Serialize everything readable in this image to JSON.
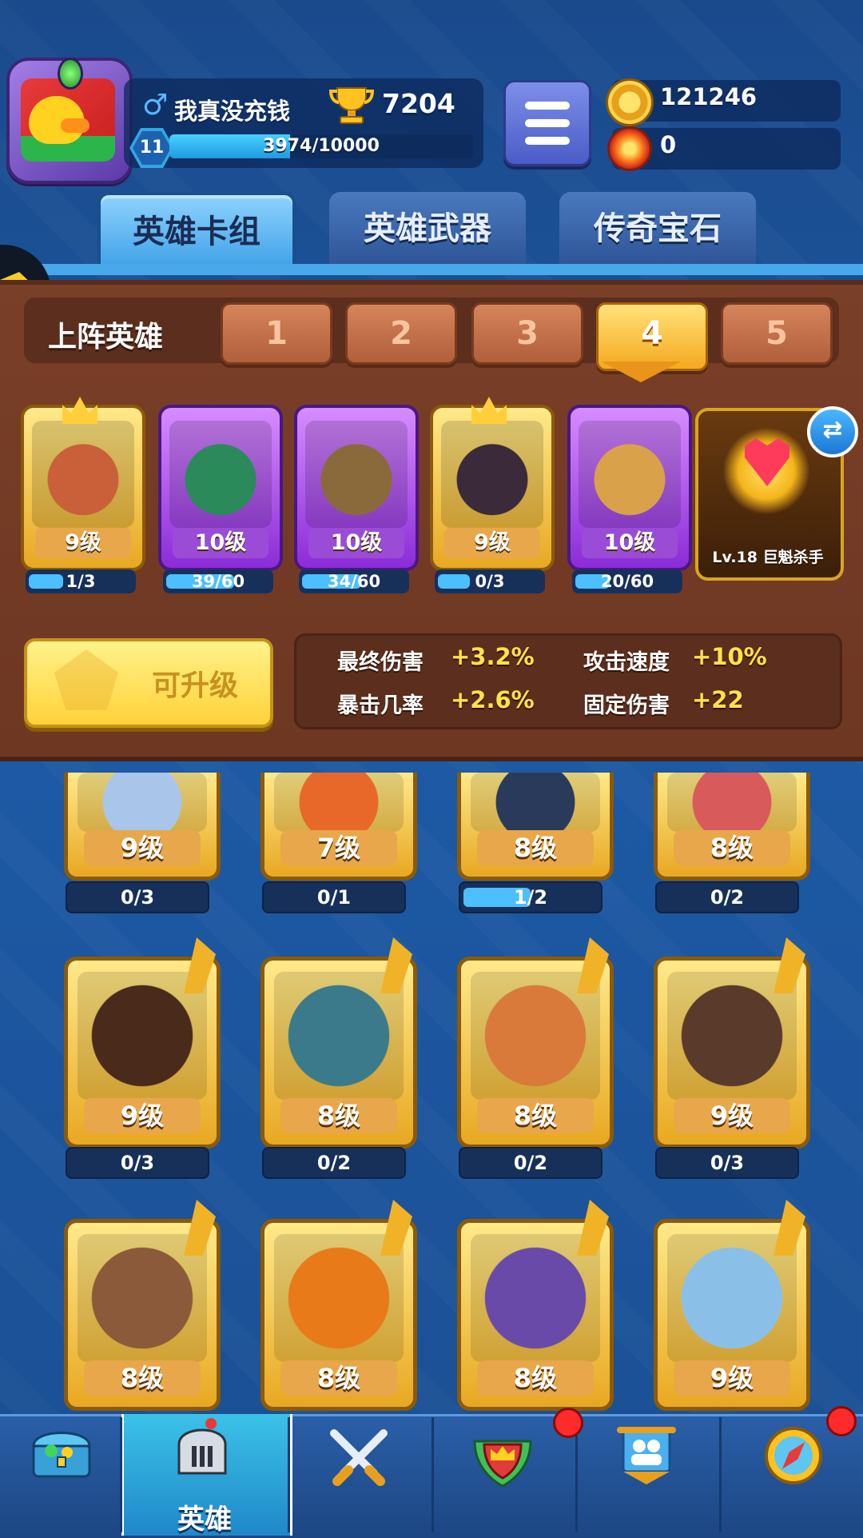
{
  "player": {
    "name": "我真没充钱",
    "trophies": "7204",
    "level": "11",
    "xp_text": "3974/10000",
    "xp_fraction": 0.3974
  },
  "currency": {
    "gold": "121246",
    "flames": "0"
  },
  "tabs": [
    {
      "label": "英雄卡组",
      "active": true
    },
    {
      "label": "英雄武器",
      "active": false
    },
    {
      "label": "传奇宝石",
      "active": false
    }
  ],
  "lineup": {
    "label": "上阵英雄",
    "slots": [
      "1",
      "2",
      "3",
      "4",
      "5"
    ],
    "active_slot": "4",
    "heroes": [
      {
        "level": "9级",
        "progress": "1/3",
        "fraction": 0.333,
        "rarity": "gold",
        "crown": true,
        "art_color": "#c9603a"
      },
      {
        "level": "10级",
        "progress": "39/60",
        "fraction": 0.65,
        "rarity": "purple",
        "crown": false,
        "art_color": "#2a8a5a"
      },
      {
        "level": "10级",
        "progress": "34/60",
        "fraction": 0.567,
        "rarity": "purple",
        "crown": false,
        "art_color": "#8a6a3a"
      },
      {
        "level": "9级",
        "progress": "0/3",
        "fraction": 0.0,
        "rarity": "gold",
        "crown": true,
        "art_color": "#3a2a3a"
      },
      {
        "level": "10级",
        "progress": "20/60",
        "fraction": 0.333,
        "rarity": "purple",
        "crown": false,
        "art_color": "#d9a24a"
      }
    ],
    "trophy_label": "Lv.18 巨魁杀手"
  },
  "upgrade": {
    "label": "可升级"
  },
  "stats": [
    {
      "name": "最终伤害",
      "value": "+3.2%"
    },
    {
      "name": "攻击速度",
      "value": "+10%"
    },
    {
      "name": "暴击几率",
      "value": "+2.6%"
    },
    {
      "name": "固定伤害",
      "value": "+22"
    }
  ],
  "roster": [
    {
      "level": "9级",
      "progress": "0/3",
      "fraction": 0.0,
      "art_color": "#a9c6ea"
    },
    {
      "level": "7级",
      "progress": "0/1",
      "fraction": 0.0,
      "art_color": "#e8682a"
    },
    {
      "level": "8级",
      "progress": "1/2",
      "fraction": 0.5,
      "art_color": "#2a3a5a"
    },
    {
      "level": "8级",
      "progress": "0/2",
      "fraction": 0.0,
      "art_color": "#d95a5a"
    },
    {
      "level": "9级",
      "progress": "0/3",
      "fraction": 0.0,
      "art_color": "#4a2a1a"
    },
    {
      "level": "8级",
      "progress": "0/2",
      "fraction": 0.0,
      "art_color": "#3a7a8a"
    },
    {
      "level": "8级",
      "progress": "0/2",
      "fraction": 0.0,
      "art_color": "#d97a3a"
    },
    {
      "level": "9级",
      "progress": "0/3",
      "fraction": 0.0,
      "art_color": "#5a3a2a"
    },
    {
      "level": "8级",
      "progress": "",
      "fraction": 0.0,
      "art_color": "#8a5a3a"
    },
    {
      "level": "8级",
      "progress": "",
      "fraction": 0.0,
      "art_color": "#e87a1a"
    },
    {
      "level": "8级",
      "progress": "",
      "fraction": 0.0,
      "art_color": "#6a4aa8"
    },
    {
      "level": "9级",
      "progress": "",
      "fraction": 0.0,
      "art_color": "#8ac0e8"
    }
  ],
  "nav": {
    "items": [
      {
        "icon": "treasure-chest-icon"
      },
      {
        "icon": "knight-helmet-icon",
        "label": "英雄",
        "active": true
      },
      {
        "icon": "crossed-swords-icon"
      },
      {
        "icon": "crown-shield-icon",
        "badge": true
      },
      {
        "icon": "guild-banner-icon"
      },
      {
        "icon": "compass-icon",
        "badge": true
      }
    ]
  }
}
